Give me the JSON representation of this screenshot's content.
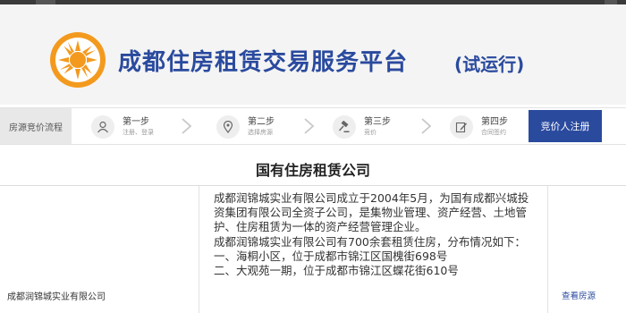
{
  "header": {
    "title": "成都住房租赁交易服务平台",
    "subtitle": "(试运行)"
  },
  "steps": {
    "flow_label": "房源竞价流程",
    "items": [
      {
        "title": "第一步",
        "sub": "注册、登录",
        "icon": "user-icon"
      },
      {
        "title": "第二步",
        "sub": "选择房源",
        "icon": "location-pin-icon"
      },
      {
        "title": "第三步",
        "sub": "竞价",
        "icon": "gavel-icon"
      },
      {
        "title": "第四步",
        "sub": "合同签约",
        "icon": "edit-icon"
      }
    ],
    "register_label": "竞价人注册"
  },
  "section": {
    "title": "国有住房租赁公司"
  },
  "company": {
    "name": "成都润锦城实业有限公司",
    "desc": [
      "成都润锦城实业有限公司成立于2004年5月，为国有成都兴城投资集团有限公司全资子公司，是集物业管理、资产经营、土地管护、住房租赁为一体的资产经营管理企业。",
      "成都润锦城实业有限公司有700余套租赁住房，分布情况如下：",
      "一、海桐小区，位于成都市锦江区国槐街698号",
      "二、大观苑一期，位于成都市锦江区蝶花街610号"
    ],
    "view_link": "查看房源"
  },
  "colors": {
    "brand": "#2a4a9e",
    "logo_orange": "#f39a1e"
  }
}
